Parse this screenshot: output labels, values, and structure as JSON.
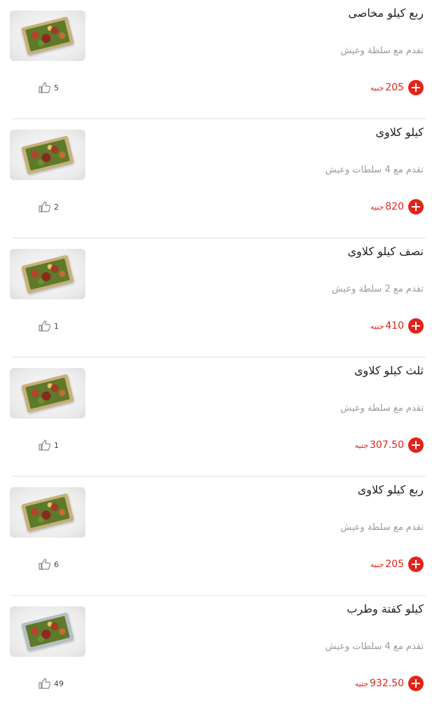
{
  "currency": "جنيه",
  "items": [
    {
      "title": "ربع كيلو مخاصى",
      "description": "تقدم مع سلطة وعيش",
      "price": "205",
      "likes": "5",
      "tray": "gold"
    },
    {
      "title": "كيلو كلاوى",
      "description": "تقدم مع 4 سلطات وعيش",
      "price": "820",
      "likes": "2",
      "tray": "gold"
    },
    {
      "title": "نصف كيلو كلاوى",
      "description": "تقدم مع 2 سلطة وعيش",
      "price": "410",
      "likes": "1",
      "tray": "gold"
    },
    {
      "title": "ثلث كيلو كلاوى",
      "description": "تقدم مع سلطة وعيش",
      "price": "307.50",
      "likes": "1",
      "tray": "gold"
    },
    {
      "title": "ربع كيلو كلاوى",
      "description": "تقدم مع سلطة وعيش",
      "price": "205",
      "likes": "6",
      "tray": "gold"
    },
    {
      "title": "كيلو كفتة وطرب",
      "description": "تقدم مع 4 سلطات وعيش",
      "price": "932.50",
      "likes": "49",
      "tray": "silver"
    }
  ],
  "icons": {
    "add": "plus-circle-icon",
    "like": "thumbs-up-icon"
  },
  "colors": {
    "accent": "#e2231a",
    "text": "#222222",
    "muted": "#9a9a9a",
    "divider": "#e2e2e2"
  }
}
